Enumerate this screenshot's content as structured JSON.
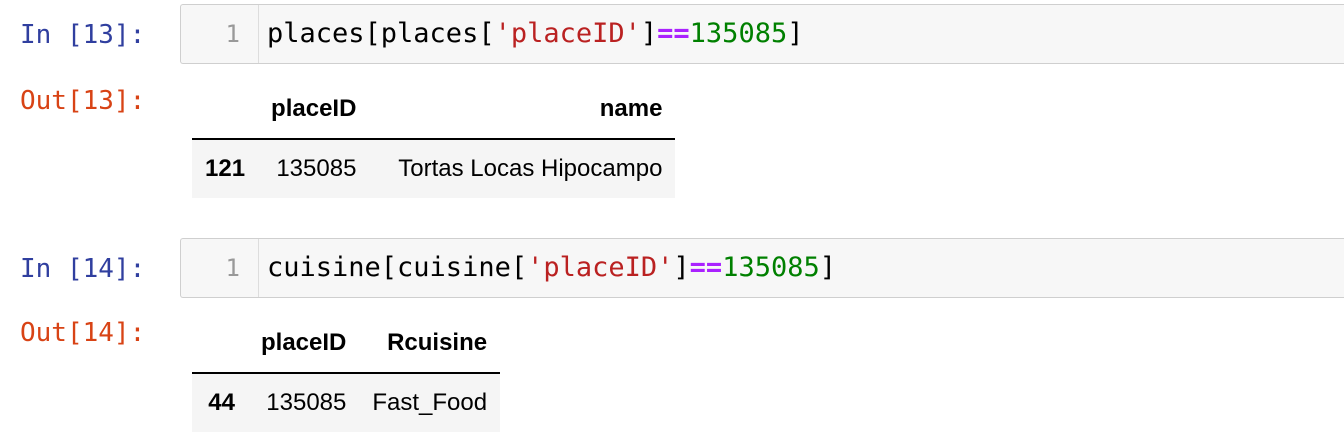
{
  "cells": [
    {
      "in_prompt": "In [13]:",
      "line_number": "1",
      "code": {
        "prefix": "places[places[",
        "string": "'placeID'",
        "bracket": "]",
        "operator": "==",
        "number": "135085",
        "suffix": "]"
      },
      "out_prompt": "Out[13]:",
      "table": {
        "columns": [
          "",
          "placeID",
          "name"
        ],
        "rows": [
          {
            "index": "121",
            "values": [
              "135085",
              "Tortas Locas Hipocampo"
            ]
          }
        ]
      }
    },
    {
      "in_prompt": "In [14]:",
      "line_number": "1",
      "code": {
        "prefix": "cuisine[cuisine[",
        "string": "'placeID'",
        "bracket": "]",
        "operator": "==",
        "number": "135085",
        "suffix": "]"
      },
      "out_prompt": "Out[14]:",
      "table": {
        "columns": [
          "",
          "placeID",
          "Rcuisine"
        ],
        "rows": [
          {
            "index": "44",
            "values": [
              "135085",
              "Fast_Food"
            ]
          }
        ]
      }
    }
  ],
  "colors": {
    "in_prompt": "#303f9f",
    "out_prompt": "#d84315",
    "string": "#ba2121",
    "operator": "#aa22ff",
    "number": "#008000"
  }
}
